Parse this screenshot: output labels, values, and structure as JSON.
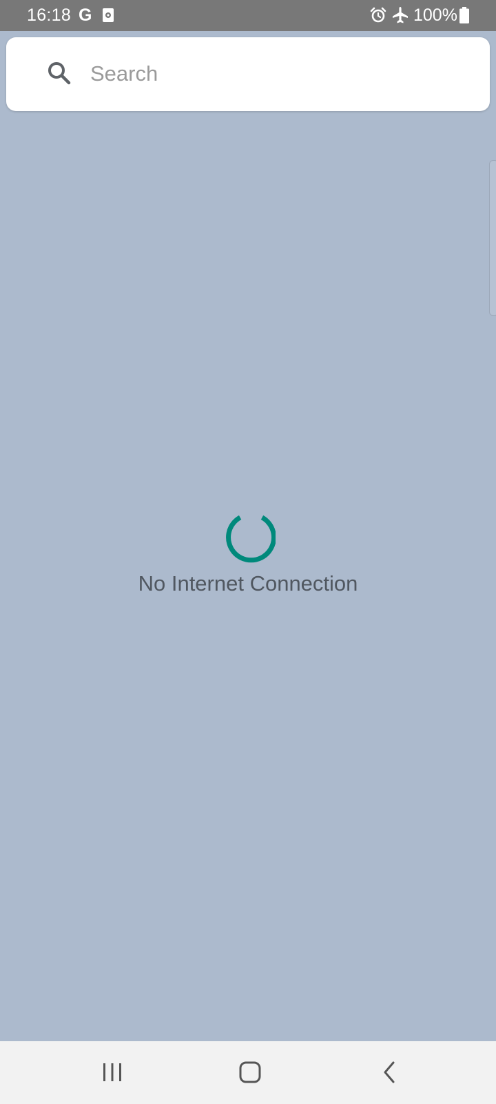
{
  "status_bar": {
    "time": "16:18",
    "google_indicator": "G",
    "battery_percent": "100%",
    "icons": [
      "app-notification-icon",
      "alarm-icon",
      "airplane-mode-icon",
      "battery-icon"
    ]
  },
  "search": {
    "placeholder": "Search",
    "value": "",
    "icon": "search-icon"
  },
  "content": {
    "message": "No Internet Connection",
    "spinner_color": "#00897b"
  },
  "navigation_bar": {
    "buttons": [
      "recent-apps",
      "home",
      "back"
    ]
  },
  "colors": {
    "map_background": "#acbacd",
    "status_bar": "#787878",
    "nav_bar": "#f2f2f2"
  }
}
